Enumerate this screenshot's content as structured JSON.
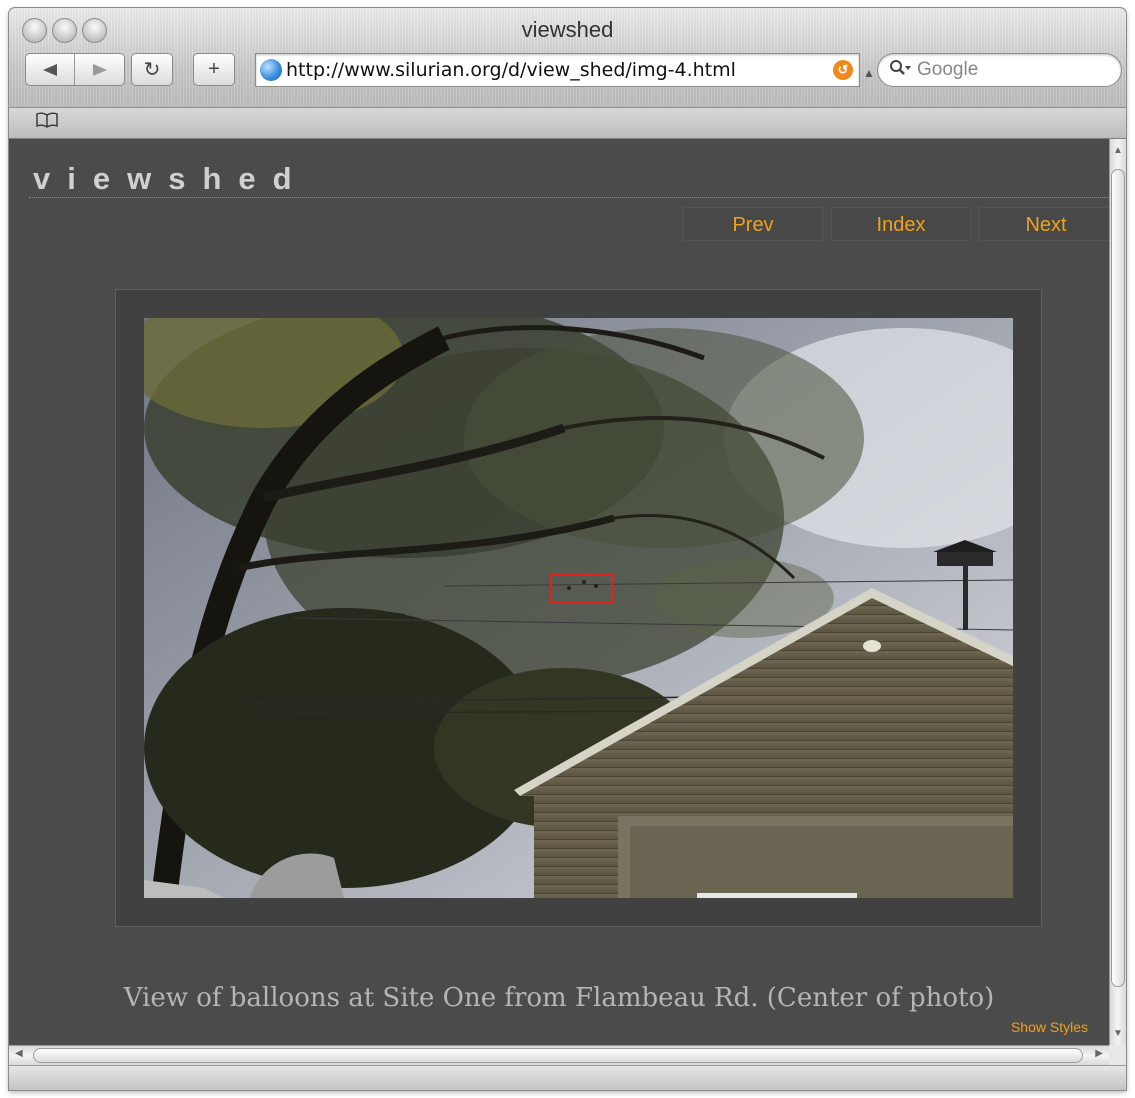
{
  "window": {
    "title": "viewshed"
  },
  "toolbar": {
    "back_icon": "back-arrow-icon",
    "forward_icon": "forward-arrow-icon",
    "reload_glyph": "↻",
    "add_bookmark_glyph": "+",
    "url": "http://www.silurian.org/d/view_shed/img-4.html",
    "search_placeholder": "Google"
  },
  "bookmarks_bar": {
    "icon": "book-icon"
  },
  "page": {
    "site_title": "viewshed",
    "nav": {
      "prev": "Prev",
      "index": "Index",
      "next": "Next"
    },
    "caption": "View of balloons at Site One from Flambeau Rd. (Center of photo)",
    "show_styles": "Show Styles",
    "accent_color": "#f0a21b",
    "background_color": "#4b4b4b"
  }
}
